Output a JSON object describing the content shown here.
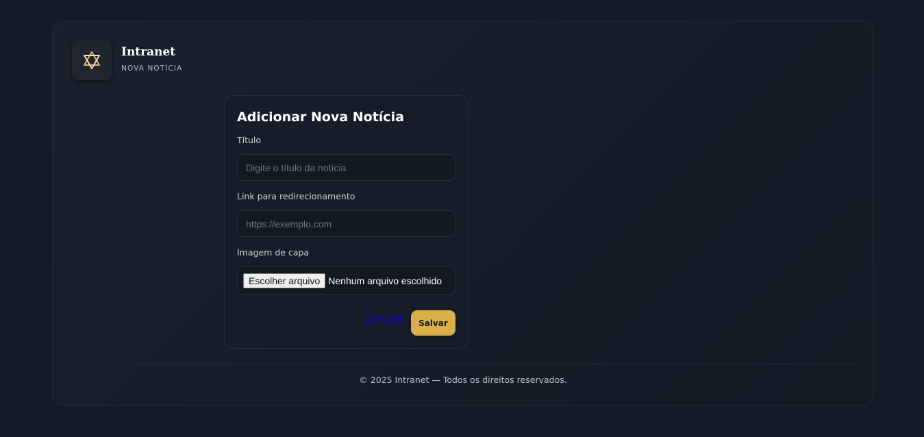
{
  "brand": {
    "logo_icon": "star-of-david-icon",
    "title": "Intranet",
    "subtitle": "NOVA NOTÍCIA"
  },
  "form": {
    "heading": "Adicionar Nova Notícia",
    "title_label": "Título",
    "title_placeholder": "Digite o título da notícia",
    "title_value": "",
    "link_label": "Link para redirecionamento",
    "link_placeholder": "https://exemplo.com",
    "link_value": "",
    "image_label": "Imagem de capa",
    "file_button_label": "Escolher arquivo",
    "file_status": "Nenhum arquivo escolhido",
    "cancel_label": "Cancelar",
    "save_label": "Salvar"
  },
  "footer": {
    "text": "© 2025 Intranet — Todos os direitos reservados."
  },
  "colors": {
    "background": "#151b26",
    "accent": "#d9ae4b",
    "link": "#0000ee"
  }
}
